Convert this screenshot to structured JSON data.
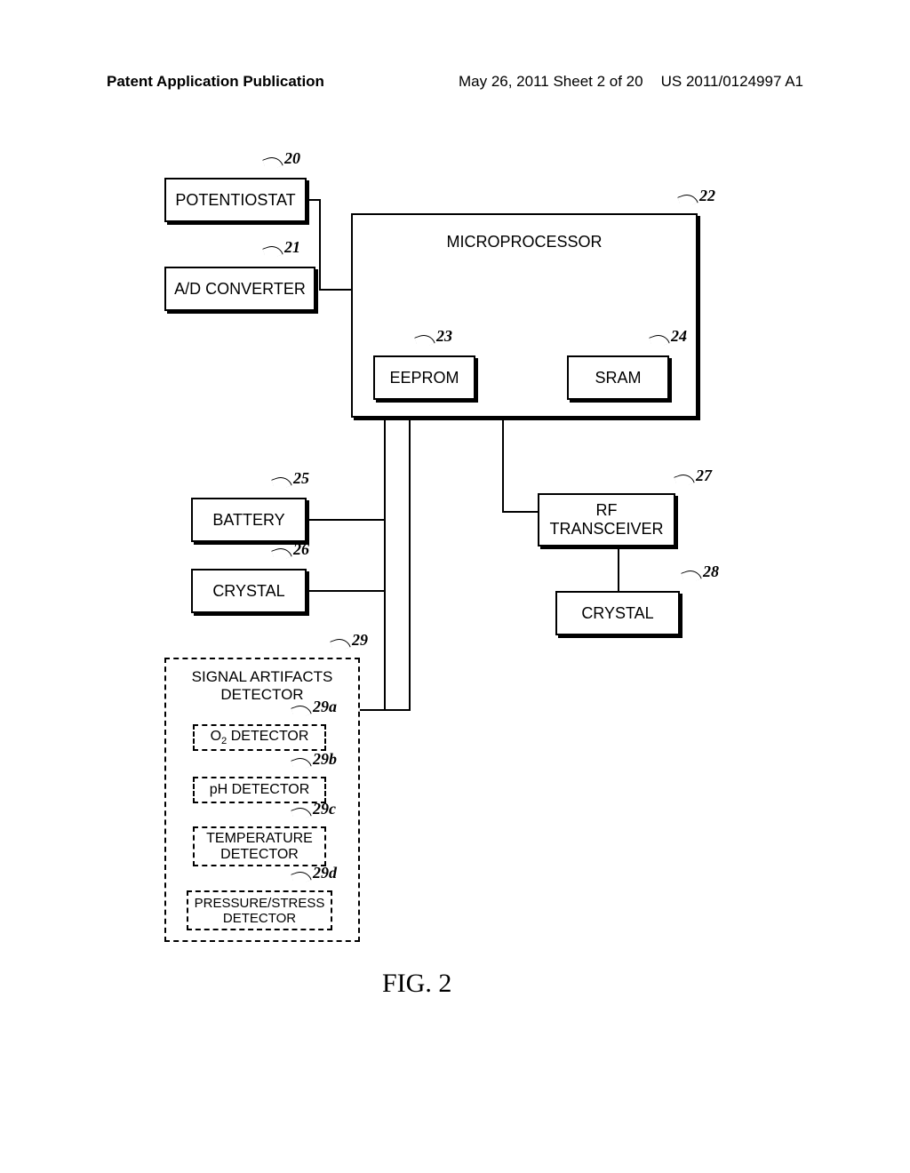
{
  "header": {
    "left": "Patent Application Publication",
    "center": "May 26, 2011  Sheet 2 of 20",
    "right": "US 2011/0124997 A1"
  },
  "boxes": {
    "potentiostat": "POTENTIOSTAT",
    "ad_converter": "A/D CONVERTER",
    "microprocessor": "MICROPROCESSOR",
    "eeprom": "EEPROM",
    "sram": "SRAM",
    "battery": "BATTERY",
    "crystal1": "CRYSTAL",
    "rf_transceiver": "RF\nTRANSCEIVER",
    "crystal2": "CRYSTAL",
    "signal_artifacts": "SIGNAL ARTIFACTS\nDETECTOR",
    "o2_detector": "O₂ DETECTOR",
    "ph_detector": "pH DETECTOR",
    "temp_detector": "TEMPERATURE\nDETECTOR",
    "pressure_detector": "PRESSURE/STRESS\nDETECTOR"
  },
  "refs": {
    "r20": "20",
    "r21": "21",
    "r22": "22",
    "r23": "23",
    "r24": "24",
    "r25": "25",
    "r26": "26",
    "r27": "27",
    "r28": "28",
    "r29": "29",
    "r29a": "29a",
    "r29b": "29b",
    "r29c": "29c",
    "r29d": "29d"
  },
  "figure_label": "FIG. 2"
}
